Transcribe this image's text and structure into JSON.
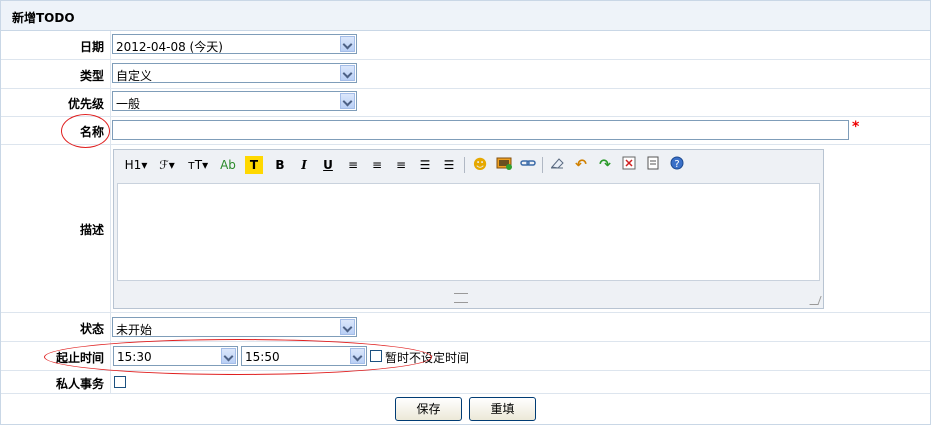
{
  "title": "新增TODO",
  "fields": {
    "date": {
      "label": "日期",
      "value": "2012-04-08 (今天)"
    },
    "type": {
      "label": "类型",
      "value": "自定义"
    },
    "priority": {
      "label": "优先级",
      "value": "一般"
    },
    "name": {
      "label": "名称",
      "value": "",
      "required_mark": "*"
    },
    "description": {
      "label": "描述"
    },
    "status": {
      "label": "状态",
      "value": "未开始"
    },
    "time": {
      "label": "起止时间",
      "start": "15:30",
      "end": "15:50",
      "no_time_label": "暂时不设定时间"
    },
    "private": {
      "label": "私人事务"
    }
  },
  "editor_toolbar": {
    "heading": "H1",
    "font": "ℱ",
    "size": "тT",
    "color": "Ab",
    "highlight": "T",
    "bold": "B",
    "italic": "I",
    "underline": "U"
  },
  "buttons": {
    "save": "保存",
    "reset": "重填"
  },
  "colors": {
    "accent_red": "#e02020",
    "header_bg": "#eef3f9",
    "border": "#c9d7e6"
  }
}
